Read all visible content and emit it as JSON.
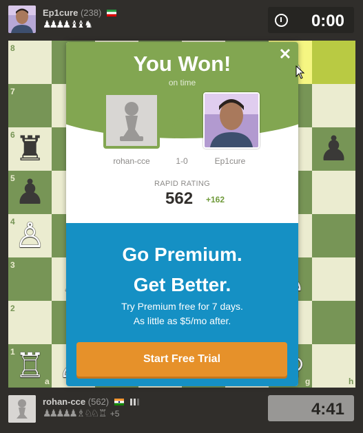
{
  "top_player": {
    "name": "Ep1cure",
    "rating": "(238)",
    "country_flag": "flag-iran-icon",
    "captured_pieces": "♟♟♟♟ ♝♝ ♞",
    "clock": "0:00"
  },
  "bottom_player": {
    "name": "rohan-cce",
    "rating": "(562)",
    "country_flag": "flag-india-icon",
    "captured_pieces": "♟♟♟♟♟ ♗ ♘♘ ♖",
    "material_advantage": "+5",
    "clock": "4:41"
  },
  "board": {
    "colors": {
      "light": "#ebecd0",
      "dark": "#779556",
      "highlight_light": "#f5f682",
      "highlight_dark": "#b9ca43"
    },
    "ranks": [
      "8",
      "7",
      "6",
      "5",
      "4",
      "3",
      "2",
      "1"
    ],
    "files": [
      "a",
      "b",
      "c",
      "d",
      "e",
      "f",
      "g",
      "h"
    ],
    "highlighted_squares": [
      "g8",
      "h8"
    ],
    "pieces": [
      {
        "square": "g8",
        "piece": "♙",
        "color": "white"
      },
      {
        "square": "a6",
        "piece": "♜",
        "color": "black"
      },
      {
        "square": "h6",
        "piece": "♟",
        "color": "black"
      },
      {
        "square": "a5",
        "piece": "♟",
        "color": "black"
      },
      {
        "square": "a4",
        "piece": "♙",
        "color": "white"
      },
      {
        "square": "a1",
        "piece": "♖",
        "color": "white"
      },
      {
        "square": "g1",
        "piece": "♔",
        "color": "white"
      },
      {
        "square": "g3",
        "piece": "♙",
        "color": "white"
      },
      {
        "square": "b3",
        "piece": "♗",
        "color": "white"
      },
      {
        "square": "b1",
        "piece": "♙",
        "color": "white"
      }
    ]
  },
  "modal": {
    "title": "You Won!",
    "subtitle": "on time",
    "close_icon": "close-icon",
    "loser_name": "rohan-cce",
    "winner_name": "Ep1cure",
    "score": "1-0",
    "timer_icon": "stopwatch-icon",
    "rating_label": "RAPID RATING",
    "rating_value": "562",
    "rating_change": "+162",
    "header_color": "#82a651",
    "promo": {
      "line1": "Go Premium.",
      "line2": "Get Better.",
      "text1": "Try Premium free for 7 days.",
      "text2": "As little as $5/mo after.",
      "button_label": "Start Free Trial",
      "background": "#1590c4",
      "button_color": "#e6912a"
    }
  }
}
